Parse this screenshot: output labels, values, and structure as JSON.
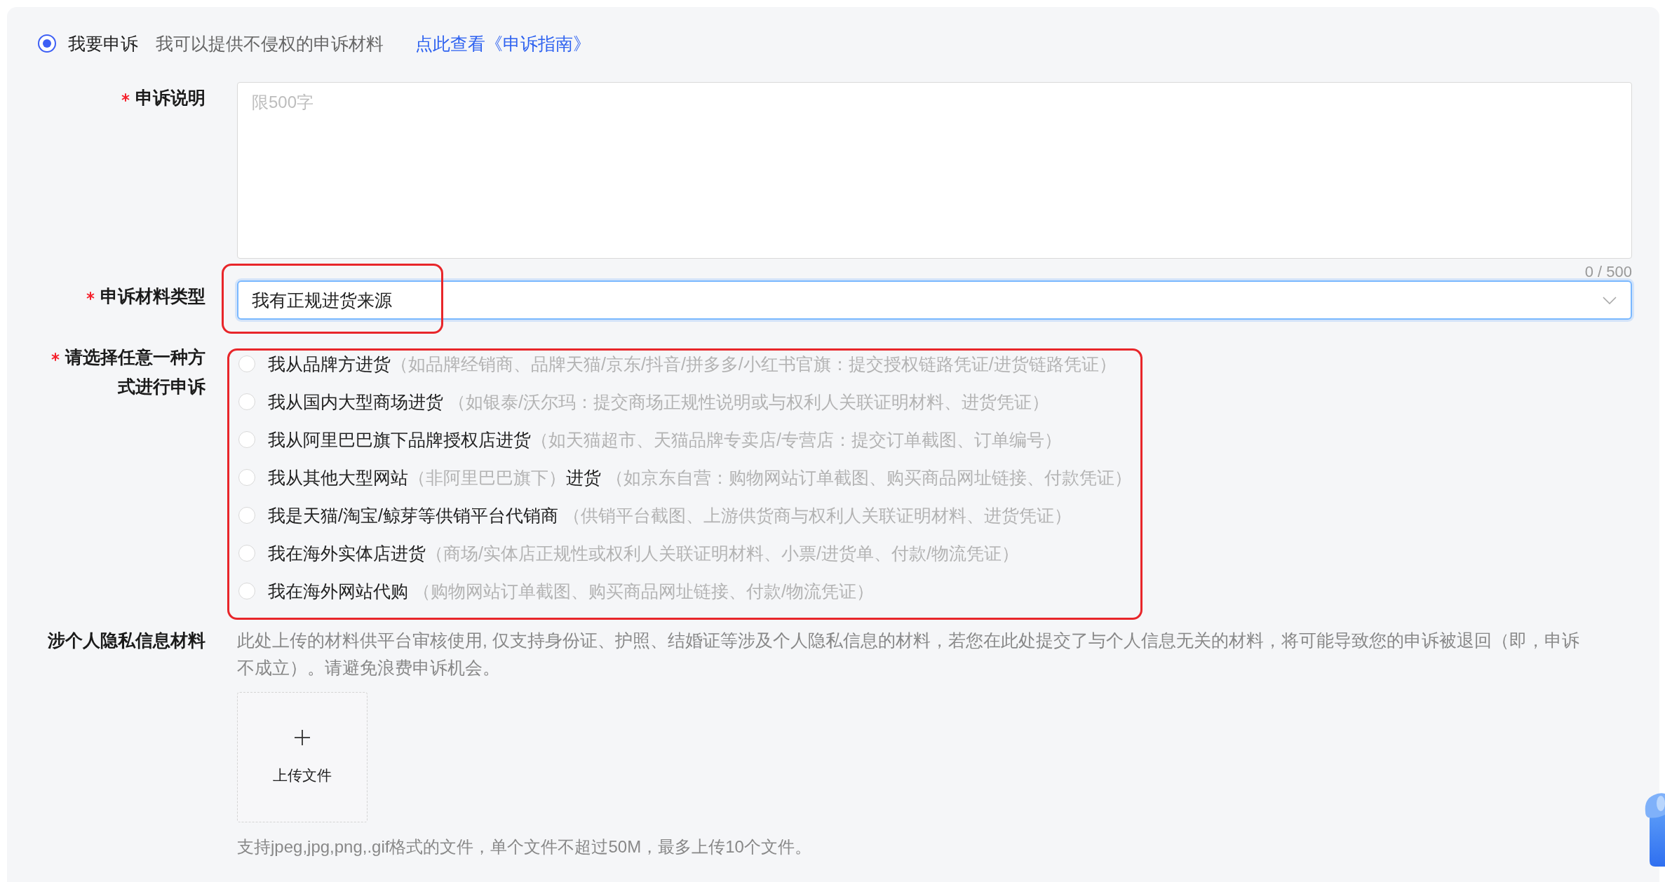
{
  "appeal_choice": {
    "selected": true,
    "label": "我要申诉",
    "description": "我可以提供不侵权的申诉材料",
    "link": "点此查看《申诉指南》"
  },
  "form": {
    "appeal_description": {
      "label": "申诉说明",
      "required": true,
      "placeholder": "限500字",
      "counter": "0 / 500"
    },
    "material_type": {
      "label": "申诉材料类型",
      "required": true,
      "value": "我有正规进货来源",
      "highlighted": true
    },
    "method": {
      "label": "请选择任意一种方式进行申诉",
      "required": true,
      "highlighted": true,
      "options": [
        {
          "selected": false,
          "segments": [
            {
              "kind": "main",
              "text": "我从品牌方进货"
            },
            {
              "kind": "hint",
              "text": "（如品牌经销商、品牌天猫/京东/抖音/拼多多/小红书官旗：提交授权链路凭证/进货链路凭证）"
            }
          ]
        },
        {
          "selected": false,
          "segments": [
            {
              "kind": "main",
              "text": "我从国内大型商场进货"
            },
            {
              "kind": "hint",
              "text": " （如银泰/沃尔玛：提交商场正规性说明或与权利人关联证明材料、进货凭证）"
            }
          ]
        },
        {
          "selected": false,
          "segments": [
            {
              "kind": "main",
              "text": "我从阿里巴巴旗下品牌授权店进货"
            },
            {
              "kind": "hint",
              "text": "（如天猫超市、天猫品牌专卖店/专营店：提交订单截图、订单编号）"
            }
          ]
        },
        {
          "selected": false,
          "segments": [
            {
              "kind": "main",
              "text": "我从其他大型网站"
            },
            {
              "kind": "hint",
              "text": "（非阿里巴巴旗下）"
            },
            {
              "kind": "main",
              "text": "进货"
            },
            {
              "kind": "hint",
              "text": " （如京东自营：购物网站订单截图、购买商品网址链接、付款凭证）"
            }
          ]
        },
        {
          "selected": false,
          "segments": [
            {
              "kind": "main",
              "text": "我是天猫/淘宝/鲸芽等供销平台代销商"
            },
            {
              "kind": "hint",
              "text": " （供销平台截图、上游供货商与权利人关联证明材料、进货凭证）"
            }
          ]
        },
        {
          "selected": false,
          "segments": [
            {
              "kind": "main",
              "text": "我在海外实体店进货"
            },
            {
              "kind": "hint",
              "text": "（商场/实体店正规性或权利人关联证明材料、小票/进货单、付款/物流凭证）"
            }
          ]
        },
        {
          "selected": false,
          "segments": [
            {
              "kind": "main",
              "text": "我在海外网站代购"
            },
            {
              "kind": "hint",
              "text": " （购物网站订单截图、购买商品网址链接、付款/物流凭证）"
            }
          ]
        }
      ]
    },
    "privacy_material": {
      "label": "涉个人隐私信息材料",
      "required": false,
      "notice": "此处上传的材料供平台审核使用, 仅支持身份证、护照、结婚证等涉及个人隐私信息的材料，若您在此处提交了与个人信息无关的材料，将可能导致您的申诉被退回（即，申诉不成立）。请避免浪费申诉机会。",
      "upload_button": "上传文件",
      "hint": "支持jpeg,jpg,png,.gif格式的文件，单个文件不超过50M，最多上传10个文件。"
    }
  }
}
